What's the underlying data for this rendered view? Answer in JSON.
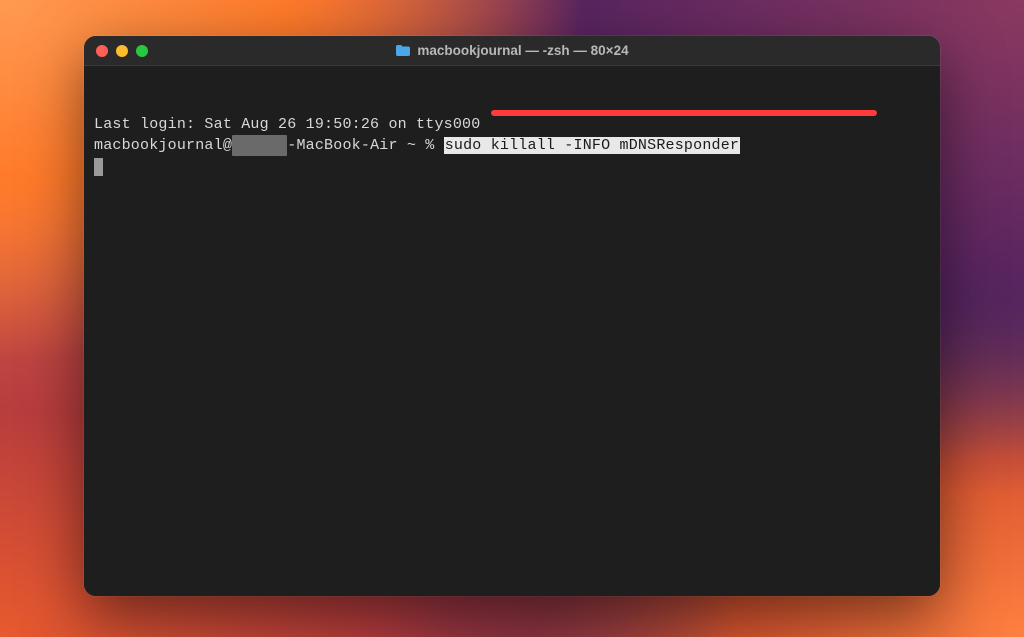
{
  "titlebar": {
    "folder_icon": "folder-icon",
    "title": "macbookjournal — -zsh — 80×24"
  },
  "terminal": {
    "last_login": "Last login: Sat Aug 26 19:50:26 on ttys000",
    "prompt_user": "macbookjournal@",
    "prompt_redacted": "      ",
    "prompt_suffix": "-MacBook-Air ~ % ",
    "command": "sudo killall -INFO mDNSResponder"
  },
  "colors": {
    "window_bg": "#1e1e1e",
    "titlebar_bg": "#2a2a2a",
    "text": "#d8d8d8",
    "highlight_bg": "#e8e8e8",
    "highlight_fg": "#1a1a1a",
    "annotation_red": "#ff3b3b",
    "traffic_close": "#ff5f57",
    "traffic_min": "#febc2e",
    "traffic_zoom": "#28c840"
  }
}
